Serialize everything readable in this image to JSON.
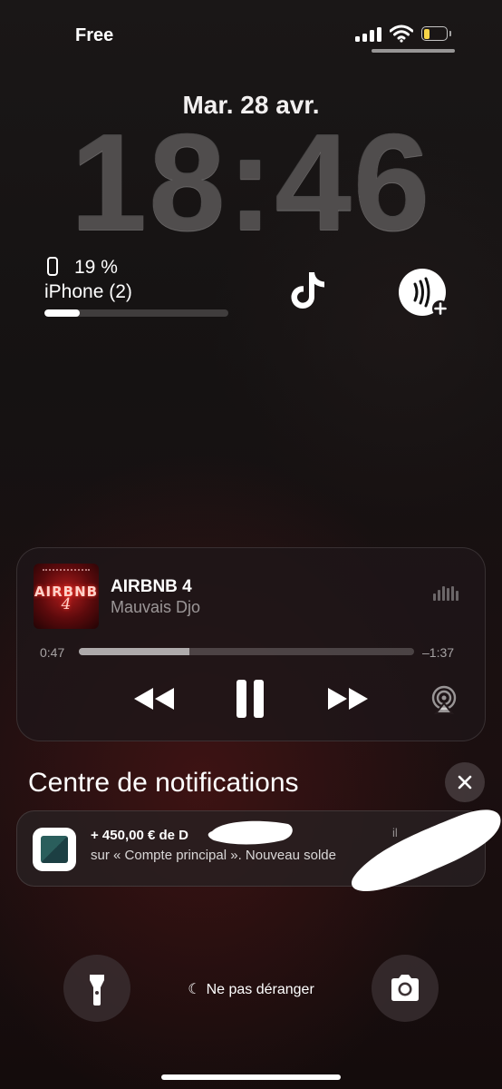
{
  "status_bar": {
    "carrier": "Free",
    "battery_level": 0.28,
    "battery_color": "#f7d548"
  },
  "lock_screen": {
    "date": "Mar. 28 avr.",
    "time": "18:46"
  },
  "battery_widget": {
    "percent": "19 %",
    "device": "iPhone (2)",
    "level": 0.19
  },
  "shortcuts": {
    "app_icons": [
      "tiktok-icon",
      "wallet-add-icon"
    ]
  },
  "now_playing": {
    "title": "AIRBNB 4",
    "artist": "Mauvais Djo",
    "artwork_text": "AIRBNB",
    "artwork_number": "4",
    "elapsed": "0:47",
    "remaining": "–1:37",
    "progress": 0.33
  },
  "notification_center": {
    "title": "Centre de notifications",
    "notification": {
      "line1": "+ 450,00 € de D",
      "line2": "sur « Compte principal ». Nouveau solde",
      "time": "il"
    }
  },
  "bottom": {
    "dnd_label": "Ne pas déranger"
  },
  "colors": {
    "accent_red": "#b51d1d",
    "app_teal": "#2a5e5c"
  }
}
